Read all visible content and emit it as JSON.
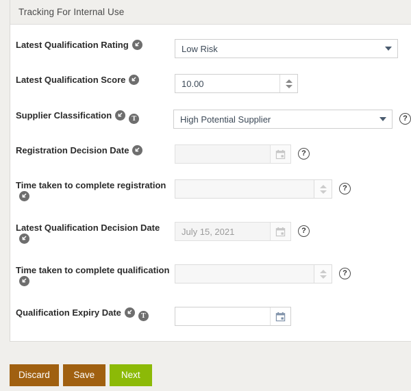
{
  "panel": {
    "title": "Tracking For Internal Use"
  },
  "icons": {
    "inherit": "inherited-value-icon",
    "translate": "translation-icon",
    "help": "?",
    "calendar": "calendar-icon",
    "caret": "chevron-down-icon"
  },
  "fields": [
    {
      "label": "Latest Qualification Rating",
      "name": "latest-qualification-rating",
      "type": "select",
      "value": "Low Risk",
      "badges": [
        "inherit"
      ],
      "help": false,
      "disabled": false
    },
    {
      "label": "Latest Qualification Score",
      "name": "latest-qualification-score",
      "type": "spinner",
      "value": "10.00",
      "badges": [
        "inherit"
      ],
      "help": false,
      "disabled": false
    },
    {
      "label": "Supplier Classification",
      "name": "supplier-classification",
      "type": "select",
      "value": "High Potential Supplier",
      "badges": [
        "inherit",
        "translate"
      ],
      "help": true,
      "disabled": false
    },
    {
      "label": "Registration Decision Date",
      "name": "registration-decision-date",
      "type": "date",
      "value": "",
      "badges": [
        "inherit"
      ],
      "help": true,
      "disabled": true
    },
    {
      "label": "Time taken to complete registration",
      "name": "time-taken-to-complete-registration",
      "type": "spinner",
      "value": "",
      "badges": [
        "inherit"
      ],
      "help": true,
      "disabled": true
    },
    {
      "label": "Latest Qualification Decision Date",
      "name": "latest-qualification-decision-date",
      "type": "date",
      "value": "July 15, 2021",
      "badges": [
        "inherit"
      ],
      "help": true,
      "disabled": true
    },
    {
      "label": "Time taken to complete qualification",
      "name": "time-taken-to-complete-qualification",
      "type": "spinner",
      "value": "",
      "badges": [
        "inherit"
      ],
      "help": true,
      "disabled": true
    },
    {
      "label": "Qualification Expiry Date",
      "name": "qualification-expiry-date",
      "type": "date",
      "value": "",
      "badges": [
        "inherit",
        "translate"
      ],
      "help": false,
      "disabled": false
    }
  ],
  "footer": {
    "discard_label": "Discard",
    "save_label": "Save",
    "next_label": "Next"
  },
  "colors": {
    "brown": "#a06010",
    "green": "#8cba07",
    "panel_header": "#f0efec",
    "page_background": "#f0efec"
  }
}
